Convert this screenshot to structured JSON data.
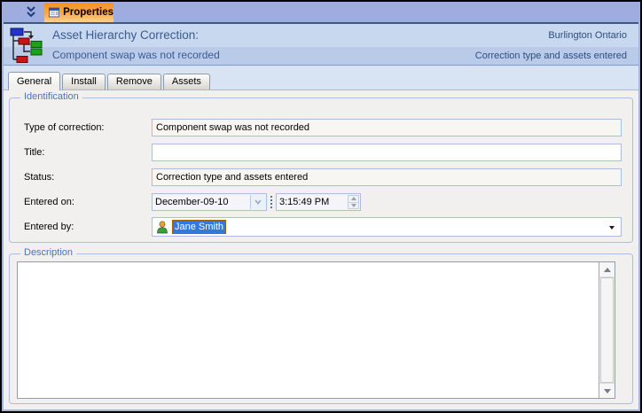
{
  "titlebar": {
    "title": "Properties"
  },
  "header": {
    "title": "Asset Hierarchy Correction:",
    "subtitle": "Component swap was not recorded",
    "location": "Burlington Ontario",
    "status": "Correction type and assets entered"
  },
  "tabs": [
    {
      "label": "General",
      "active": true
    },
    {
      "label": "Install",
      "active": false
    },
    {
      "label": "Remove",
      "active": false
    },
    {
      "label": "Assets",
      "active": false
    }
  ],
  "ident": {
    "legend": "Identification",
    "type_label": "Type of correction:",
    "type_value": "Component swap was not recorded",
    "title_label": "Title:",
    "title_value": "",
    "status_label": "Status:",
    "status_value": "Correction type and assets entered",
    "entered_on_label": "Entered on:",
    "date_value": "December-09-10",
    "time_value": "3:15:49 PM",
    "entered_by_label": "Entered by:",
    "entered_by_value": "Jane Smith"
  },
  "desc": {
    "legend": "Description",
    "content": ""
  },
  "icons": {
    "titlebar_collapse": "chevron-double-down-icon",
    "properties_tab": "window-form-icon",
    "header": "asset-hierarchy-icon",
    "entered_by": "person-icon"
  },
  "colors": {
    "titlebar_bg": "#9EACE0",
    "tab_accent_orange": "#F6921E",
    "header_band": "#C8D8EF",
    "header_text": "#3A5A92",
    "group_label_blue": "#4C71BE",
    "selection_bg": "#3279DD",
    "selection_border": "#A66000"
  }
}
